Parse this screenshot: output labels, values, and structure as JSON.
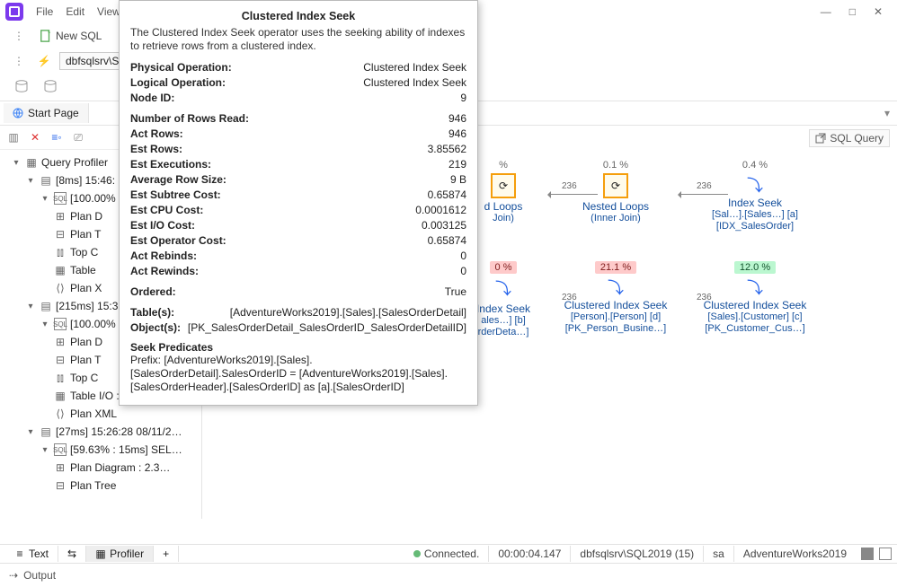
{
  "menu": {
    "file": "File",
    "edit": "Edit",
    "view": "View"
  },
  "window_controls": {
    "min": "—",
    "max": "□",
    "close": "✕"
  },
  "toolbar": {
    "new_sql": "New SQL"
  },
  "crumb": "dbfsqlsrv\\SQL",
  "tabs": {
    "start_page": "Start Page"
  },
  "right_chip": "SQL Query",
  "tree": {
    "root_label": "Query Profiler",
    "n1": "[8ms] 15:46:",
    "n1_pct": "[100.00%",
    "n1_items": {
      "diagram": "Plan D",
      "tree": "Plan T",
      "topc": "Top C",
      "table": "Table",
      "xml": "Plan X"
    },
    "n2": "[215ms] 15:3",
    "n2_pct": "[100.00%",
    "n2_items": {
      "diagram": "Plan D",
      "tree": "Plan T",
      "topc": "Top C",
      "tableio": "Table I/O : 0",
      "xml": "Plan XML"
    },
    "n3": "[27ms] 15:26:28 08/11/2…",
    "n3_pct": "[59.63% : 15ms] SEL…",
    "n3_items": {
      "diagram": "Plan Diagram : 2.3…",
      "tree": "Plan Tree"
    }
  },
  "tooltip": {
    "title": "Clustered Index Seek",
    "desc": "The Clustered Index Seek operator uses the seeking ability of indexes to retrieve rows from a clustered index.",
    "rows": [
      {
        "k": "Physical Operation:",
        "v": "Clustered Index Seek"
      },
      {
        "k": "Logical Operation:",
        "v": "Clustered Index Seek"
      },
      {
        "k": "Node ID:",
        "v": "9"
      },
      {
        "k": "Number of Rows Read:",
        "v": "946"
      },
      {
        "k": "Act Rows:",
        "v": "946"
      },
      {
        "k": "Est Rows:",
        "v": "3.85562"
      },
      {
        "k": "Est Executions:",
        "v": "219"
      },
      {
        "k": "Average Row Size:",
        "v": "9 B"
      },
      {
        "k": "Est Subtree Cost:",
        "v": "0.65874"
      },
      {
        "k": "Est CPU Cost:",
        "v": "0.0001612"
      },
      {
        "k": "Est I/O Cost:",
        "v": "0.003125"
      },
      {
        "k": "Est Operator Cost:",
        "v": "0.65874"
      },
      {
        "k": "Act Rebinds:",
        "v": "0"
      },
      {
        "k": "Act Rewinds:",
        "v": "0"
      },
      {
        "k": "Ordered:",
        "v": "True"
      },
      {
        "k": "Table(s):",
        "v": "[AdventureWorks2019].[Sales].[SalesOrderDetail]"
      },
      {
        "k": "Object(s):",
        "v": "[PK_SalesOrderDetail_SalesOrderID_SalesOrderDetailID]"
      }
    ],
    "seek_heading": "Seek Predicates",
    "seek_text": "Prefix: [AdventureWorks2019].[Sales].[SalesOrderDetail].SalesOrderID = [AdventureWorks2019].[Sales].[SalesOrderHeader].[SalesOrderID] as [a].[SalesOrderID]"
  },
  "plan": {
    "col1": {
      "pct_top": "%",
      "top": {
        "title": "d Loops",
        "sub": "Join)"
      },
      "badge": "0 %",
      "bot": {
        "title": "Index Seek",
        "sub1": "ales…] [b]",
        "sub2": "rderDeta…]"
      }
    },
    "col2": {
      "pct_top": "0.1 %",
      "count_in": "236",
      "top": {
        "title": "Nested Loops",
        "sub": "(Inner Join)"
      },
      "badge": "21.1 %",
      "count_bot": "236",
      "bot": {
        "title": "Clustered Index Seek",
        "sub1": "[Person].[Person] [d]",
        "sub2": "[PK_Person_Busine…]"
      }
    },
    "col3": {
      "pct_top": "0.4 %",
      "count_in": "236",
      "top": {
        "title": "Index Seek",
        "sub1": "[Sal…].[Sales…] [a]",
        "sub2": "[IDX_SalesOrder]"
      },
      "badge": "12.0 %",
      "count_bot": "236",
      "bot": {
        "title": "Clustered Index Seek",
        "sub1": "[Sales].[Customer] [c]",
        "sub2": "[PK_Customer_Cus…]"
      }
    }
  },
  "status": {
    "text_tab": "Text",
    "swap": "⇆",
    "profiler": "Profiler",
    "plus": "+",
    "connected": "Connected.",
    "time": "00:00:04.147",
    "server": "dbfsqlsrv\\SQL2019 (15)",
    "user": "sa",
    "db": "AdventureWorks2019"
  },
  "output_label": "Output"
}
